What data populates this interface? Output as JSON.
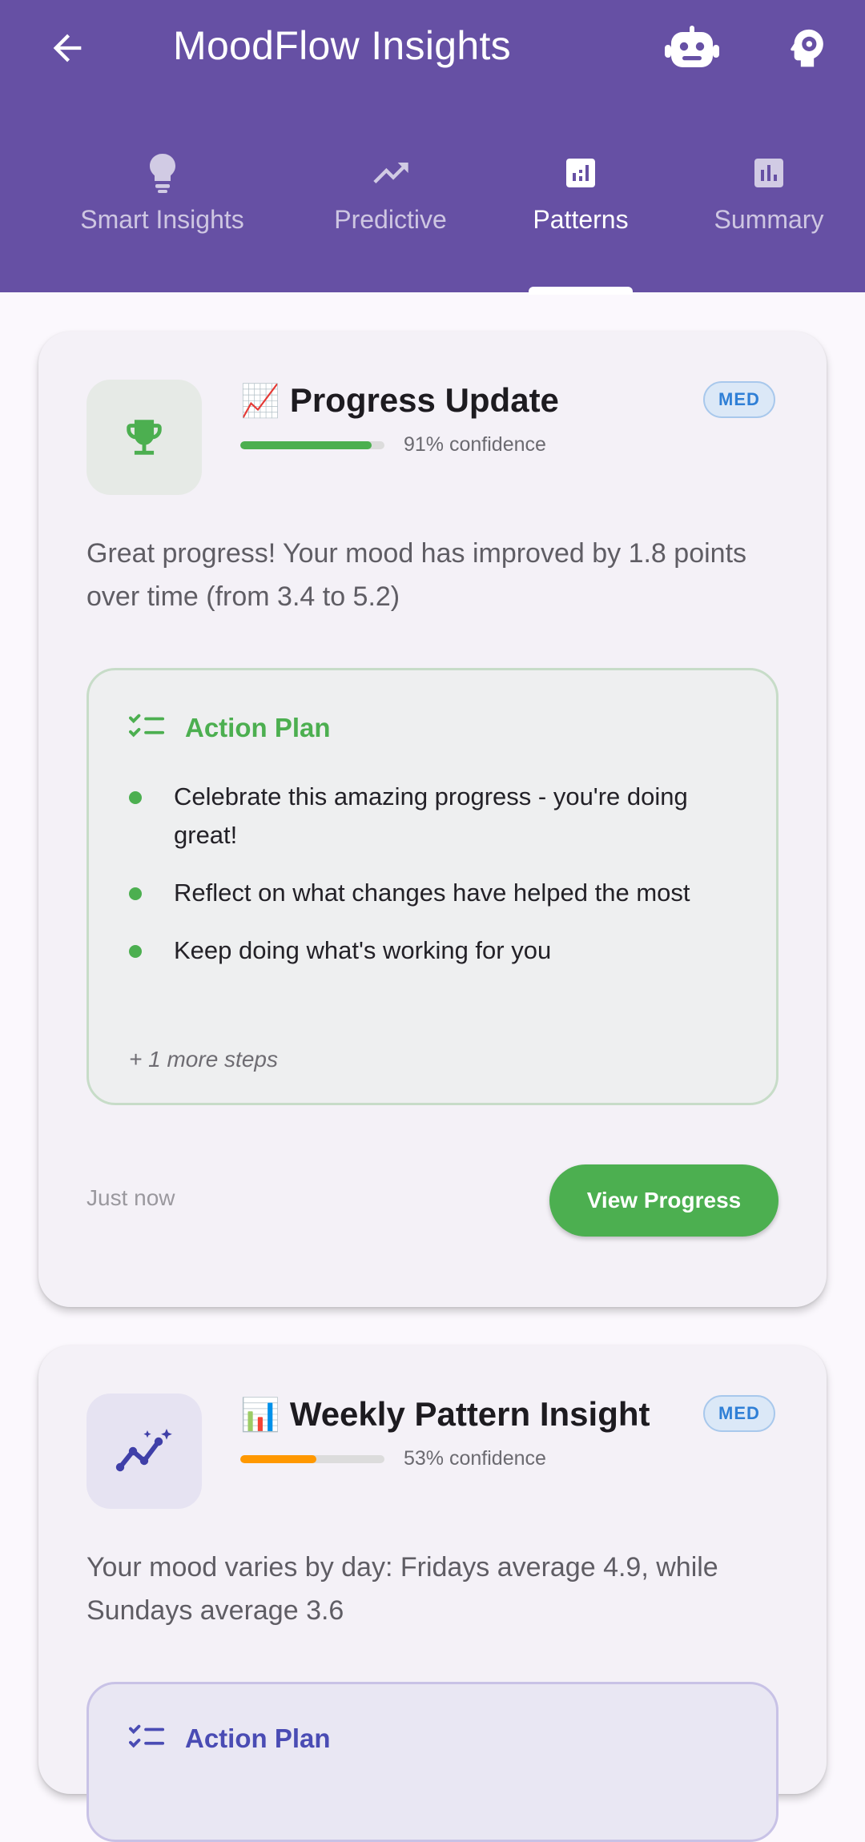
{
  "app": {
    "title": "MoodFlow Insights",
    "colors": {
      "primary": "#6650a4",
      "success": "#4caf50",
      "warning": "#ff9800",
      "accent": "#4a4cb4",
      "badge": "#2f7fd6"
    }
  },
  "header": {
    "back_icon": "arrow-left-icon",
    "actions": [
      {
        "name": "robot-icon"
      },
      {
        "name": "brain-settings-icon"
      }
    ]
  },
  "tabs": [
    {
      "label": "Smart Insights",
      "icon": "lightbulb-icon",
      "active": false
    },
    {
      "label": "Predictive",
      "icon": "trending-up-icon",
      "active": false
    },
    {
      "label": "Patterns",
      "icon": "bar-chart-icon",
      "active": true
    },
    {
      "label": "Summary",
      "icon": "bar-chart-icon",
      "active": false
    }
  ],
  "insights": [
    {
      "emoji": "📈",
      "title": "Progress Update",
      "priority": "MED",
      "confidence": 0.91,
      "confidence_text": "91% confidence",
      "icon": "trophy-icon",
      "description": "Great progress! Your mood has improved by 1.8 points over time (from 3.4 to 5.2)",
      "action_plan": {
        "title": "Action Plan",
        "steps": [
          "Celebrate this amazing progress - you're doing great!",
          "Reflect on what changes have helped the most",
          "Keep doing what's working for you"
        ],
        "more": "+ 1 more steps"
      },
      "timestamp": "Just now",
      "cta": "View Progress"
    },
    {
      "emoji": "📊",
      "title": "Weekly Pattern Insight",
      "priority": "MED",
      "confidence": 0.53,
      "confidence_text": "53% confidence",
      "icon": "sparkle-trend-icon",
      "description": "Your mood varies by day: Fridays average 4.9, while Sundays average 3.6",
      "action_plan": {
        "title": "Action Plan"
      }
    }
  ]
}
